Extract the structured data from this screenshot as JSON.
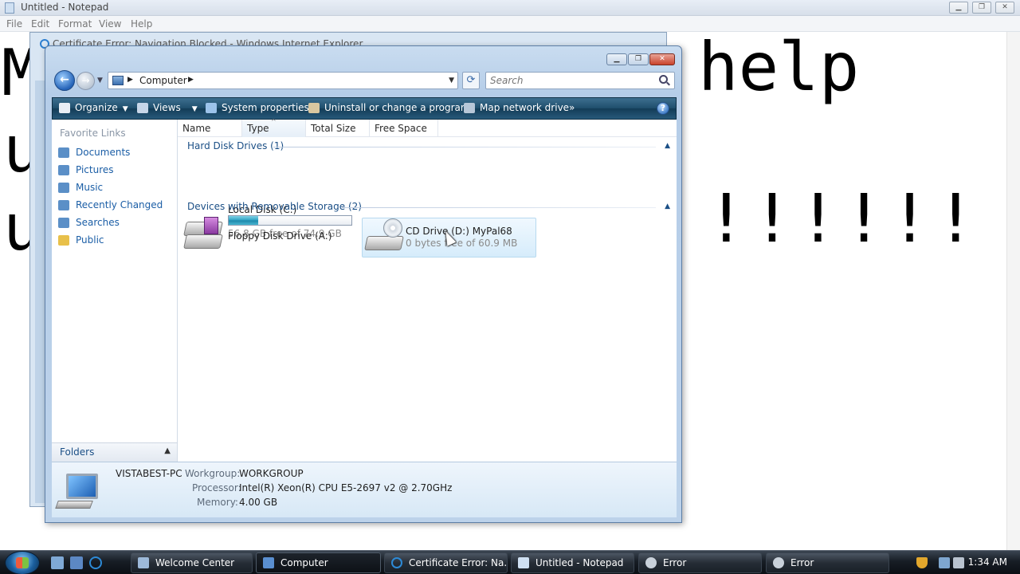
{
  "notepad": {
    "title": "Untitled - Notepad",
    "menu": [
      "File",
      "Edit",
      "Format",
      "View",
      "Help"
    ],
    "text_fragments": [
      "M",
      "help",
      "u",
      "u",
      "!!!!!!",
      "!"
    ]
  },
  "ie_window": {
    "title": "Certificate Error: Navigation Blocked - Windows Internet Explorer"
  },
  "explorer": {
    "address": {
      "crumb": "Computer"
    },
    "search": {
      "placeholder": "Search"
    },
    "commands": {
      "organize": "Organize",
      "views": "Views",
      "system_properties": "System properties",
      "uninstall": "Uninstall or change a program",
      "map_drive": "Map network drive",
      "more": "»"
    },
    "nav": {
      "favorite_links_header": "Favorite Links",
      "items": [
        {
          "label": "Documents",
          "icon": "documents-icon",
          "color": "#5b8fc7"
        },
        {
          "label": "Pictures",
          "icon": "pictures-icon",
          "color": "#5b8fc7"
        },
        {
          "label": "Music",
          "icon": "music-icon",
          "color": "#5b8fc7"
        },
        {
          "label": "Recently Changed",
          "icon": "recently-changed-icon",
          "color": "#5b8fc7"
        },
        {
          "label": "Searches",
          "icon": "searches-icon",
          "color": "#5b8fc7"
        },
        {
          "label": "Public",
          "icon": "public-folder-icon",
          "color": "#e8c04a"
        }
      ],
      "folders_label": "Folders"
    },
    "columns": [
      "Name",
      "Type",
      "Total Size",
      "Free Space"
    ],
    "groups": {
      "hard_disk": {
        "header": "Hard Disk Drives (1)",
        "drive": {
          "name": "Local Disk (C:)",
          "free": "56.8 GB free of 74.9 GB",
          "used_fraction": 0.24
        }
      },
      "removable": {
        "header": "Devices with Removable Storage (2)",
        "floppy": {
          "name": "Floppy Disk Drive (A:)"
        },
        "cd": {
          "name": "CD Drive (D:) MyPal68",
          "free": "0 bytes free of 60.9 MB"
        }
      }
    },
    "details": {
      "computer_name": "VISTABEST-PC",
      "workgroup_label": "Workgroup:",
      "workgroup": "WORKGROUP",
      "processor_label": "Processor:",
      "processor": "Intel(R) Xeon(R) CPU E5-2697 v2 @ 2.70GHz",
      "memory_label": "Memory:",
      "memory": "4.00 GB"
    },
    "colors": {
      "accent": "#1b5ea6",
      "command_bar": "#1e4d6b",
      "selection": "#d6ecfb"
    }
  },
  "taskbar": {
    "tasks": [
      {
        "label": "Welcome Center",
        "icon": "welcome-center-icon"
      },
      {
        "label": "Computer",
        "icon": "computer-icon"
      },
      {
        "label": "Certificate Error: Na...",
        "icon": "ie-icon"
      },
      {
        "label": "Untitled - Notepad",
        "icon": "notepad-icon"
      },
      {
        "label": "Error",
        "icon": "error-icon"
      },
      {
        "label": "Error",
        "icon": "error-icon"
      }
    ],
    "clock": "1:34 AM"
  }
}
